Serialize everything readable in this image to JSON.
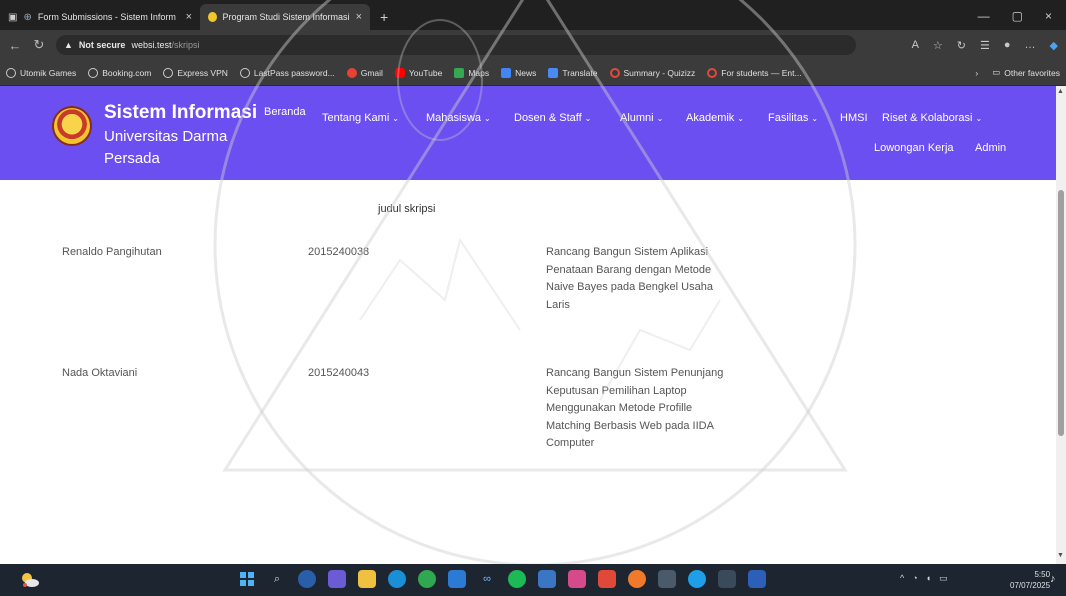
{
  "browser": {
    "tabs": [
      {
        "label": "Form Submissions - Sistem Inform",
        "close": "×"
      },
      {
        "label": "Program Studi Sistem Informasi",
        "close": "×"
      }
    ],
    "new_tab": "+",
    "window_controls": [
      "—",
      "▢",
      "×"
    ],
    "address": {
      "security": "Not secure",
      "host": "websi.test",
      "path": "/skripsi"
    },
    "bookmarks": [
      "Utomik Games",
      "Booking.com",
      "Express VPN",
      "LastPass password...",
      "Gmail",
      "YouTube",
      "Maps",
      "News",
      "Translate",
      "Summary - Quizizz",
      "For students — Ent..."
    ],
    "bookmarks_more": "›",
    "other_favorites": "Other favorites"
  },
  "site": {
    "brand": {
      "line1": "Sistem Informasi",
      "line2": "Universitas Darma",
      "line3": "Persada"
    },
    "menu": {
      "beranda": "Beranda",
      "tentang": "Tentang Kami",
      "mahasiswa": "Mahasiswa",
      "dosen": "Dosen & Staff",
      "alumni": "Alumni",
      "akademik": "Akademik",
      "fasilitas": "Fasilitas",
      "hmsi": "HMSI",
      "riset": "Riset & Kolaborasi",
      "lowongan": "Lowongan Kerja",
      "admin": "Admin"
    },
    "caret": "⌄"
  },
  "table": {
    "header_judul": "judul skripsi",
    "rows": [
      {
        "name": "Renaldo Pangihutan",
        "nim": "2015240038",
        "title_lines": [
          "Rancang Bangun Sistem Aplikasi",
          "Penataan Barang dengan Metode",
          "Naive Bayes pada Bengkel Usaha",
          "Laris"
        ]
      },
      {
        "name": "Nada Oktaviani",
        "nim": "2015240043",
        "title_lines": [
          "Rancang Bangun Sistem Penunjang",
          "Keputusan Pemilihan Laptop",
          "Menggunakan Metode Profille",
          "Matching Berbasis Web pada IIDA",
          "Computer"
        ]
      }
    ]
  },
  "taskbar": {
    "time": "5:50",
    "date": "07/07/2025"
  },
  "colors": {
    "nav": "#6b4ff0",
    "chrome": "#3b3b3b",
    "taskbar": "#1c2530"
  }
}
